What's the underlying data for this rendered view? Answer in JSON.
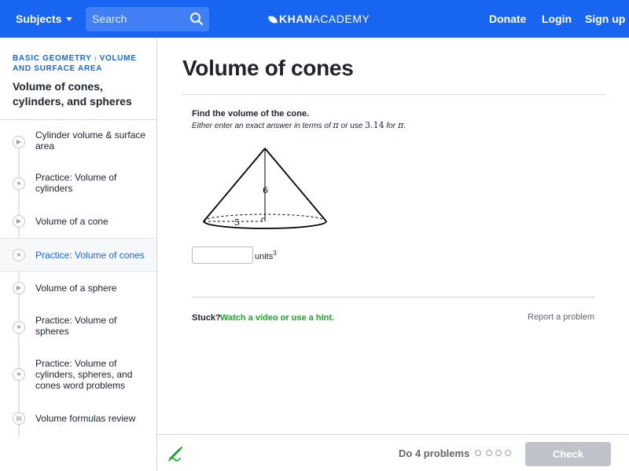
{
  "header": {
    "subjects_label": "Subjects",
    "search_placeholder": "Search",
    "logo_bold": "KHAN",
    "logo_light": "ACADEMY",
    "donate_label": "Donate",
    "login_label": "Login",
    "signup_label": "Sign up",
    "brand_color": "#1865f2"
  },
  "sidebar": {
    "breadcrumb_1": "Basic geometry",
    "breadcrumb_2": "Volume and surface area",
    "unit_title": "Volume of cones, cylinders, and spheres",
    "items": [
      {
        "label": "Cylinder volume & surface area",
        "icon": "play-icon",
        "active": false
      },
      {
        "label": "Practice: Volume of cylinders",
        "icon": "star-icon",
        "active": false
      },
      {
        "label": "Volume of a cone",
        "icon": "play-icon",
        "active": false
      },
      {
        "label": "Practice: Volume of cones",
        "icon": "star-icon",
        "active": true
      },
      {
        "label": "Volume of a sphere",
        "icon": "play-icon",
        "active": false
      },
      {
        "label": "Practice: Volume of spheres",
        "icon": "star-icon",
        "active": false
      },
      {
        "label": "Practice: Volume of cylinders, spheres, and cones word problems",
        "icon": "star-icon",
        "active": false
      },
      {
        "label": "Volume formulas review",
        "icon": "article-icon",
        "active": false
      }
    ]
  },
  "main": {
    "title": "Volume of cones",
    "instruction": "Find the volume of the cone.",
    "note_prefix": "Either enter an exact answer in terms of",
    "note_pi_1": "π",
    "note_middle": "or use",
    "note_value": "3.14",
    "note_for": "for",
    "note_pi_2": "π",
    "note_end": ".",
    "cone_height": "6",
    "cone_radius": "5",
    "answer_value": "",
    "units_label": "units",
    "units_exponent": "3",
    "stuck_label": "Stuck?",
    "hint_label": "Watch a video or use a hint.",
    "report_label": "Report a problem"
  },
  "footer": {
    "do_label": "Do 4 problems",
    "problem_count": 4,
    "completed": 0,
    "check_label": "Check"
  }
}
